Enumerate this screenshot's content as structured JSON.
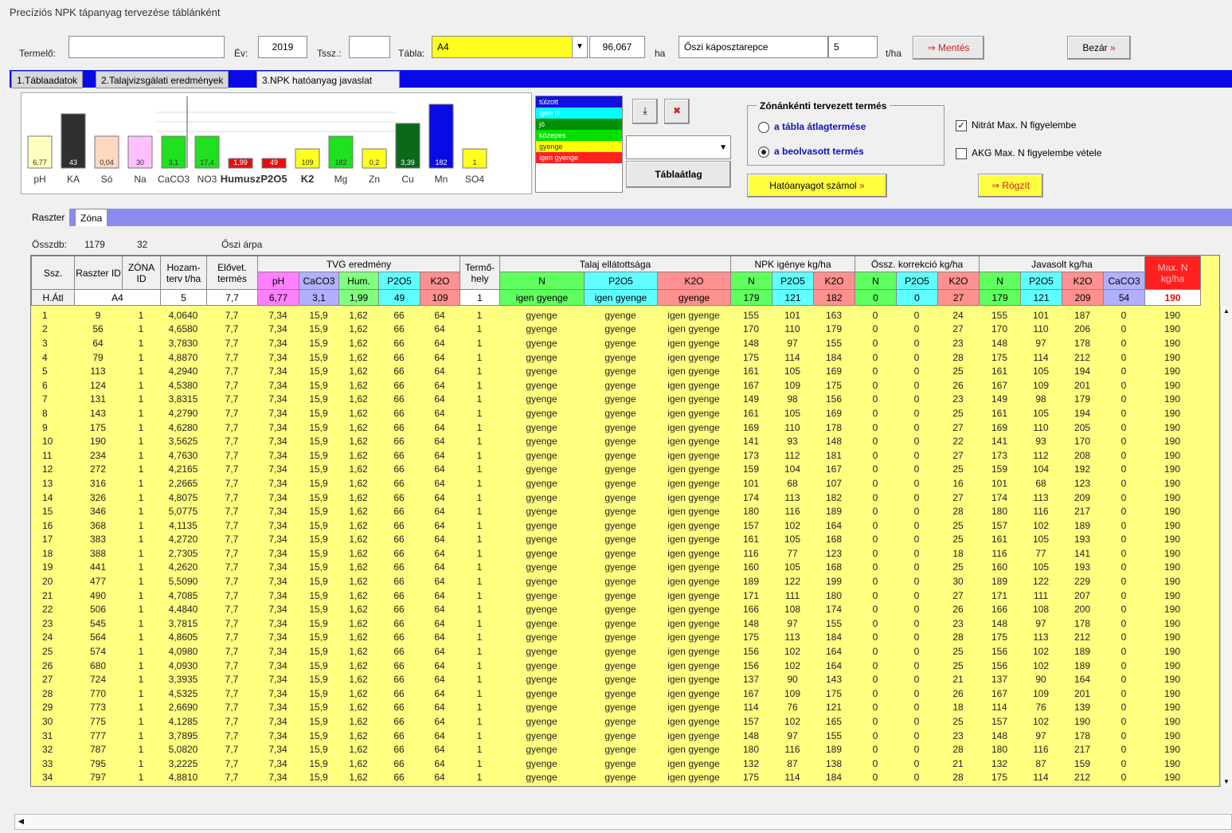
{
  "window_title": "Precíziós NPK tápanyag tervezése táblánként",
  "header": {
    "producer_label": "Termelő:",
    "producer_value": "",
    "year_label": "Év:",
    "year_value": "2019",
    "tssz_label": "Tssz.:",
    "tssz_value": "",
    "table_label": "Tábla:",
    "table_value": "A4",
    "area_value": "96,067",
    "area_unit": "ha",
    "crop_value": "Őszi káposztarepce",
    "yield_value": "5",
    "yield_unit": "t/ha",
    "save_label": "Mentés",
    "close_label": "Bezár"
  },
  "tabs": [
    "1.Táblaadatok",
    "2.Talajvizsgálati eredmények",
    "3.NPK hatóanyag javaslat"
  ],
  "chart_data": {
    "type": "bar",
    "categories": [
      "pH",
      "KA",
      "Só",
      "Na",
      "CaCO3",
      "NO3",
      "Humusz",
      "P2O5",
      "K2",
      "Mg",
      "Zn",
      "Cu",
      "Mn",
      "SO4"
    ],
    "values": [
      "6,77",
      "43",
      "0,04",
      "30",
      "3,1",
      "17,4",
      "1,99",
      "49",
      "109",
      "182",
      "0,2",
      "3,39",
      "182",
      "1"
    ],
    "colors": [
      "#ffffc0",
      "#303030",
      "#ffd8c0",
      "#ffc0ff",
      "#20e020",
      "#20e020",
      "#e01010",
      "#e01010",
      "#ffff20",
      "#20e020",
      "#ffff20",
      "#0a6a1a",
      "#0a0ae6",
      "#ffff20"
    ],
    "level_labels": [
      "túlzott",
      "igen jó",
      "jó",
      "közepes",
      "gyenge",
      "igen gyenge"
    ],
    "level_colors": [
      "#1010e0",
      "#00ffff",
      "#009000",
      "#00e000",
      "#ffff00",
      "#ff2020"
    ]
  },
  "side_buttons": {
    "table_avg_label": "Táblaátlag"
  },
  "zone_group": {
    "title": "Zónánkénti tervezett termés",
    "option1": "a tábla átlagtermése",
    "option2": "a beolvasott termés",
    "nitrate_check": "Nitrát Max. N figyelembe",
    "akg_check": "AKG Max. N figyelembe vétele",
    "calc_button": "Hatóanyagot számol",
    "record_button": "Rögzít"
  },
  "subtabs": [
    "Raszter",
    "Zóna"
  ],
  "summary": {
    "count_label": "Összdb:",
    "count_value": "1179",
    "second_value": "32",
    "prev_crop": "Őszi árpa"
  },
  "table_headers": {
    "group": [
      "TVG eredmény",
      "Talaj ellátottsága",
      "NPK igénye kg/ha",
      "Össz. korrekció kg/ha",
      "Javasolt kg/ha",
      "Max. N kg/ha"
    ],
    "fixed": [
      "Ssz.",
      "Raszter ID",
      "ZÓNA ID",
      "Hozam-terv t/ha",
      "Elővet. termés",
      "Termő-hely"
    ],
    "tvg": [
      "pH",
      "CaCO3",
      "Hum.",
      "P2O5",
      "K2O"
    ],
    "talaj": [
      "N",
      "P2O5",
      "K2O"
    ],
    "npk": [
      "N",
      "P2O5",
      "K2O"
    ],
    "korr": [
      "N",
      "P2O5",
      "K2O"
    ],
    "jav": [
      "N",
      "P2O5",
      "K2O",
      "CaCO3"
    ]
  },
  "avg_row": [
    "H.Átl",
    "A4",
    "",
    "5",
    "7,7",
    "6,77",
    "3,1",
    "1,99",
    "49",
    "109",
    "1",
    "igen gyenge",
    "igen gyenge",
    "gyenge",
    "179",
    "121",
    "182",
    "0",
    "0",
    "27",
    "179",
    "121",
    "209",
    "54",
    "190"
  ],
  "rows": [
    [
      "1",
      "9",
      "1",
      "4,0640",
      "7,7",
      "7,34",
      "15,9",
      "1,62",
      "66",
      "64",
      "1",
      "gyenge",
      "gyenge",
      "igen gyenge",
      "155",
      "101",
      "163",
      "0",
      "0",
      "24",
      "155",
      "101",
      "187",
      "0",
      "190"
    ],
    [
      "2",
      "56",
      "1",
      "4,6580",
      "7,7",
      "7,34",
      "15,9",
      "1,62",
      "66",
      "64",
      "1",
      "gyenge",
      "gyenge",
      "igen gyenge",
      "170",
      "110",
      "179",
      "0",
      "0",
      "27",
      "170",
      "110",
      "206",
      "0",
      "190"
    ],
    [
      "3",
      "64",
      "1",
      "3,7830",
      "7,7",
      "7,34",
      "15,9",
      "1,62",
      "66",
      "64",
      "1",
      "gyenge",
      "gyenge",
      "igen gyenge",
      "148",
      "97",
      "155",
      "0",
      "0",
      "23",
      "148",
      "97",
      "178",
      "0",
      "190"
    ],
    [
      "4",
      "79",
      "1",
      "4,8870",
      "7,7",
      "7,34",
      "15,9",
      "1,62",
      "66",
      "64",
      "1",
      "gyenge",
      "gyenge",
      "igen gyenge",
      "175",
      "114",
      "184",
      "0",
      "0",
      "28",
      "175",
      "114",
      "212",
      "0",
      "190"
    ],
    [
      "5",
      "113",
      "1",
      "4,2940",
      "7,7",
      "7,34",
      "15,9",
      "1,62",
      "66",
      "64",
      "1",
      "gyenge",
      "gyenge",
      "igen gyenge",
      "161",
      "105",
      "169",
      "0",
      "0",
      "25",
      "161",
      "105",
      "194",
      "0",
      "190"
    ],
    [
      "6",
      "124",
      "1",
      "4,5380",
      "7,7",
      "7,34",
      "15,9",
      "1,62",
      "66",
      "64",
      "1",
      "gyenge",
      "gyenge",
      "igen gyenge",
      "167",
      "109",
      "175",
      "0",
      "0",
      "26",
      "167",
      "109",
      "201",
      "0",
      "190"
    ],
    [
      "7",
      "131",
      "1",
      "3,8315",
      "7,7",
      "7,34",
      "15,9",
      "1,62",
      "66",
      "64",
      "1",
      "gyenge",
      "gyenge",
      "igen gyenge",
      "149",
      "98",
      "156",
      "0",
      "0",
      "23",
      "149",
      "98",
      "179",
      "0",
      "190"
    ],
    [
      "8",
      "143",
      "1",
      "4,2790",
      "7,7",
      "7,34",
      "15,9",
      "1,62",
      "66",
      "64",
      "1",
      "gyenge",
      "gyenge",
      "igen gyenge",
      "161",
      "105",
      "169",
      "0",
      "0",
      "25",
      "161",
      "105",
      "194",
      "0",
      "190"
    ],
    [
      "9",
      "175",
      "1",
      "4,6280",
      "7,7",
      "7,34",
      "15,9",
      "1,62",
      "66",
      "64",
      "1",
      "gyenge",
      "gyenge",
      "igen gyenge",
      "169",
      "110",
      "178",
      "0",
      "0",
      "27",
      "169",
      "110",
      "205",
      "0",
      "190"
    ],
    [
      "10",
      "190",
      "1",
      "3,5625",
      "7,7",
      "7,34",
      "15,9",
      "1,62",
      "66",
      "64",
      "1",
      "gyenge",
      "gyenge",
      "igen gyenge",
      "141",
      "93",
      "148",
      "0",
      "0",
      "22",
      "141",
      "93",
      "170",
      "0",
      "190"
    ],
    [
      "11",
      "234",
      "1",
      "4,7630",
      "7,7",
      "7,34",
      "15,9",
      "1,62",
      "66",
      "64",
      "1",
      "gyenge",
      "gyenge",
      "igen gyenge",
      "173",
      "112",
      "181",
      "0",
      "0",
      "27",
      "173",
      "112",
      "208",
      "0",
      "190"
    ],
    [
      "12",
      "272",
      "1",
      "4,2165",
      "7,7",
      "7,34",
      "15,9",
      "1,62",
      "66",
      "64",
      "1",
      "gyenge",
      "gyenge",
      "igen gyenge",
      "159",
      "104",
      "167",
      "0",
      "0",
      "25",
      "159",
      "104",
      "192",
      "0",
      "190"
    ],
    [
      "13",
      "316",
      "1",
      "2,2665",
      "7,7",
      "7,34",
      "15,9",
      "1,62",
      "66",
      "64",
      "1",
      "gyenge",
      "gyenge",
      "igen gyenge",
      "101",
      "68",
      "107",
      "0",
      "0",
      "16",
      "101",
      "68",
      "123",
      "0",
      "190"
    ],
    [
      "14",
      "326",
      "1",
      "4,8075",
      "7,7",
      "7,34",
      "15,9",
      "1,62",
      "66",
      "64",
      "1",
      "gyenge",
      "gyenge",
      "igen gyenge",
      "174",
      "113",
      "182",
      "0",
      "0",
      "27",
      "174",
      "113",
      "209",
      "0",
      "190"
    ],
    [
      "15",
      "346",
      "1",
      "5,0775",
      "7,7",
      "7,34",
      "15,9",
      "1,62",
      "66",
      "64",
      "1",
      "gyenge",
      "gyenge",
      "igen gyenge",
      "180",
      "116",
      "189",
      "0",
      "0",
      "28",
      "180",
      "116",
      "217",
      "0",
      "190"
    ],
    [
      "16",
      "368",
      "1",
      "4,1135",
      "7,7",
      "7,34",
      "15,9",
      "1,62",
      "66",
      "64",
      "1",
      "gyenge",
      "gyenge",
      "igen gyenge",
      "157",
      "102",
      "164",
      "0",
      "0",
      "25",
      "157",
      "102",
      "189",
      "0",
      "190"
    ],
    [
      "17",
      "383",
      "1",
      "4,2720",
      "7,7",
      "7,34",
      "15,9",
      "1,62",
      "66",
      "64",
      "1",
      "gyenge",
      "gyenge",
      "igen gyenge",
      "161",
      "105",
      "168",
      "0",
      "0",
      "25",
      "161",
      "105",
      "193",
      "0",
      "190"
    ],
    [
      "18",
      "388",
      "1",
      "2,7305",
      "7,7",
      "7,34",
      "15,9",
      "1,62",
      "66",
      "64",
      "1",
      "gyenge",
      "gyenge",
      "igen gyenge",
      "116",
      "77",
      "123",
      "0",
      "0",
      "18",
      "116",
      "77",
      "141",
      "0",
      "190"
    ],
    [
      "19",
      "441",
      "1",
      "4,2620",
      "7,7",
      "7,34",
      "15,9",
      "1,62",
      "66",
      "64",
      "1",
      "gyenge",
      "gyenge",
      "igen gyenge",
      "160",
      "105",
      "168",
      "0",
      "0",
      "25",
      "160",
      "105",
      "193",
      "0",
      "190"
    ],
    [
      "20",
      "477",
      "1",
      "5,5090",
      "7,7",
      "7,34",
      "15,9",
      "1,62",
      "66",
      "64",
      "1",
      "gyenge",
      "gyenge",
      "igen gyenge",
      "189",
      "122",
      "199",
      "0",
      "0",
      "30",
      "189",
      "122",
      "229",
      "0",
      "190"
    ],
    [
      "21",
      "490",
      "1",
      "4,7085",
      "7,7",
      "7,34",
      "15,9",
      "1,62",
      "66",
      "64",
      "1",
      "gyenge",
      "gyenge",
      "igen gyenge",
      "171",
      "111",
      "180",
      "0",
      "0",
      "27",
      "171",
      "111",
      "207",
      "0",
      "190"
    ],
    [
      "22",
      "506",
      "1",
      "4,4840",
      "7,7",
      "7,34",
      "15,9",
      "1,62",
      "66",
      "64",
      "1",
      "gyenge",
      "gyenge",
      "igen gyenge",
      "166",
      "108",
      "174",
      "0",
      "0",
      "26",
      "166",
      "108",
      "200",
      "0",
      "190"
    ],
    [
      "23",
      "545",
      "1",
      "3,7815",
      "7,7",
      "7,34",
      "15,9",
      "1,62",
      "66",
      "64",
      "1",
      "gyenge",
      "gyenge",
      "igen gyenge",
      "148",
      "97",
      "155",
      "0",
      "0",
      "23",
      "148",
      "97",
      "178",
      "0",
      "190"
    ],
    [
      "24",
      "564",
      "1",
      "4,8605",
      "7,7",
      "7,34",
      "15,9",
      "1,62",
      "66",
      "64",
      "1",
      "gyenge",
      "gyenge",
      "igen gyenge",
      "175",
      "113",
      "184",
      "0",
      "0",
      "28",
      "175",
      "113",
      "212",
      "0",
      "190"
    ],
    [
      "25",
      "574",
      "1",
      "4,0980",
      "7,7",
      "7,34",
      "15,9",
      "1,62",
      "66",
      "64",
      "1",
      "gyenge",
      "gyenge",
      "igen gyenge",
      "156",
      "102",
      "164",
      "0",
      "0",
      "25",
      "156",
      "102",
      "189",
      "0",
      "190"
    ],
    [
      "26",
      "680",
      "1",
      "4,0930",
      "7,7",
      "7,34",
      "15,9",
      "1,62",
      "66",
      "64",
      "1",
      "gyenge",
      "gyenge",
      "igen gyenge",
      "156",
      "102",
      "164",
      "0",
      "0",
      "25",
      "156",
      "102",
      "189",
      "0",
      "190"
    ],
    [
      "27",
      "724",
      "1",
      "3,3935",
      "7,7",
      "7,34",
      "15,9",
      "1,62",
      "66",
      "64",
      "1",
      "gyenge",
      "gyenge",
      "igen gyenge",
      "137",
      "90",
      "143",
      "0",
      "0",
      "21",
      "137",
      "90",
      "164",
      "0",
      "190"
    ],
    [
      "28",
      "770",
      "1",
      "4,5325",
      "7,7",
      "7,34",
      "15,9",
      "1,62",
      "66",
      "64",
      "1",
      "gyenge",
      "gyenge",
      "igen gyenge",
      "167",
      "109",
      "175",
      "0",
      "0",
      "26",
      "167",
      "109",
      "201",
      "0",
      "190"
    ],
    [
      "29",
      "773",
      "1",
      "2,6690",
      "7,7",
      "7,34",
      "15,9",
      "1,62",
      "66",
      "64",
      "1",
      "gyenge",
      "gyenge",
      "igen gyenge",
      "114",
      "76",
      "121",
      "0",
      "0",
      "18",
      "114",
      "76",
      "139",
      "0",
      "190"
    ],
    [
      "30",
      "775",
      "1",
      "4,1285",
      "7,7",
      "7,34",
      "15,9",
      "1,62",
      "66",
      "64",
      "1",
      "gyenge",
      "gyenge",
      "igen gyenge",
      "157",
      "102",
      "165",
      "0",
      "0",
      "25",
      "157",
      "102",
      "190",
      "0",
      "190"
    ],
    [
      "31",
      "777",
      "1",
      "3,7895",
      "7,7",
      "7,34",
      "15,9",
      "1,62",
      "66",
      "64",
      "1",
      "gyenge",
      "gyenge",
      "igen gyenge",
      "148",
      "97",
      "155",
      "0",
      "0",
      "23",
      "148",
      "97",
      "178",
      "0",
      "190"
    ],
    [
      "32",
      "787",
      "1",
      "5,0820",
      "7,7",
      "7,34",
      "15,9",
      "1,62",
      "66",
      "64",
      "1",
      "gyenge",
      "gyenge",
      "igen gyenge",
      "180",
      "116",
      "189",
      "0",
      "0",
      "28",
      "180",
      "116",
      "217",
      "0",
      "190"
    ],
    [
      "33",
      "795",
      "1",
      "3,2225",
      "7,7",
      "7,34",
      "15,9",
      "1,62",
      "66",
      "64",
      "1",
      "gyenge",
      "gyenge",
      "igen gyenge",
      "132",
      "87",
      "138",
      "0",
      "0",
      "21",
      "132",
      "87",
      "159",
      "0",
      "190"
    ],
    [
      "34",
      "797",
      "1",
      "4,8810",
      "7,7",
      "7,34",
      "15,9",
      "1,62",
      "66",
      "64",
      "1",
      "gyenge",
      "gyenge",
      "igen gyenge",
      "175",
      "114",
      "184",
      "0",
      "0",
      "28",
      "175",
      "114",
      "212",
      "0",
      "190"
    ]
  ]
}
